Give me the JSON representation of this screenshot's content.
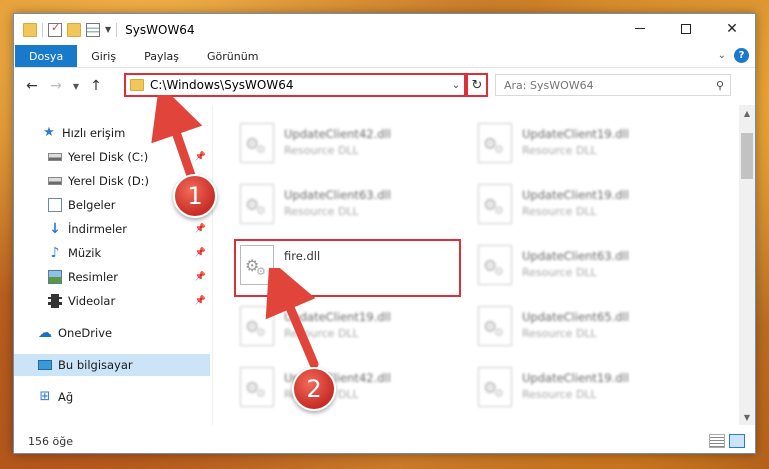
{
  "window": {
    "title": "SysWOW64",
    "controls": {
      "minimize_icon": "minimize-icon",
      "maximize_icon": "maximize-icon",
      "close_label": "✕"
    }
  },
  "ribbon": {
    "tabs": [
      {
        "label": "Dosya"
      },
      {
        "label": "Giriş"
      },
      {
        "label": "Paylaş"
      },
      {
        "label": "Görünüm"
      }
    ],
    "help_label": "?"
  },
  "navigation": {
    "address_path": "C:\\Windows\\SysWOW64",
    "search_placeholder": "Ara: SysWOW64"
  },
  "sidebar": {
    "items": [
      {
        "label": "Hızlı erişim",
        "icon": "star-icon"
      },
      {
        "label": "Yerel Disk (C:)",
        "icon": "disk-icon",
        "pinned": true
      },
      {
        "label": "Yerel Disk (D:)",
        "icon": "disk-icon",
        "pinned": false
      },
      {
        "label": "Belgeler",
        "icon": "document-icon",
        "pinned": true
      },
      {
        "label": "İndirmeler",
        "icon": "download-icon",
        "pinned": true
      },
      {
        "label": "Müzik",
        "icon": "music-icon",
        "pinned": true
      },
      {
        "label": "Resimler",
        "icon": "picture-icon",
        "pinned": true
      },
      {
        "label": "Videolar",
        "icon": "video-icon",
        "pinned": true
      },
      {
        "label": "OneDrive",
        "icon": "cloud-icon"
      },
      {
        "label": "Bu bilgisayar",
        "icon": "computer-icon",
        "selected": true
      },
      {
        "label": "Ağ",
        "icon": "network-icon"
      }
    ]
  },
  "files": [
    {
      "name": "UpdateClient42.dll",
      "type": "Resource DLL",
      "blurred": true
    },
    {
      "name": "UpdateClient19.dll",
      "type": "Resource DLL",
      "blurred": true
    },
    {
      "name": "UpdateClient63.dll",
      "type": "Resource DLL",
      "blurred": true
    },
    {
      "name": "UpdateClient19.dll",
      "type": "Resource DLL",
      "blurred": true
    },
    {
      "name": "fire.dll",
      "type": "",
      "blurred": false,
      "highlighted": true
    },
    {
      "name": "UpdateClient63.dll",
      "type": "Resource DLL",
      "blurred": true
    },
    {
      "name": "UpdateClient19.dll",
      "type": "Resource DLL",
      "blurred": true
    },
    {
      "name": "UpdateClient65.dll",
      "type": "Resource DLL",
      "blurred": true
    },
    {
      "name": "UpdateClient42.dll",
      "type": "Resource DLL",
      "blurred": true
    },
    {
      "name": "UpdateClient19.dll",
      "type": "Resource DLL",
      "blurred": true
    }
  ],
  "status": {
    "item_count": "156 öğe"
  },
  "callouts": [
    {
      "number": "1"
    },
    {
      "number": "2"
    }
  ],
  "colors": {
    "accent": "#1979ca",
    "highlight": "#d9303a",
    "selected": "#cce4f7"
  }
}
